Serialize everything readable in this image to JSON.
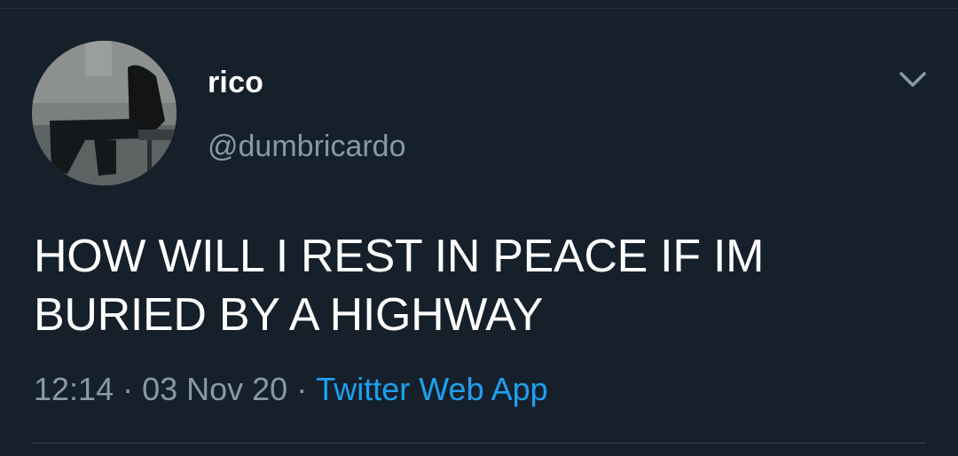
{
  "tweet": {
    "author": {
      "display_name": "rico",
      "handle": "@dumbricardo"
    },
    "text_line_1": "HOW WILL I REST IN PEACE IF IM",
    "text_line_2": "BURIED BY A HIGHWAY",
    "time": "12:14",
    "date": "03 Nov 20",
    "separator": "·",
    "source": "Twitter Web App"
  },
  "icons": {
    "menu": "chevron-down-icon"
  },
  "colors": {
    "background": "#15202b",
    "primary_text": "#ffffff",
    "secondary_text": "#8899a6",
    "link": "#1da1f2",
    "divider": "#38444d"
  }
}
